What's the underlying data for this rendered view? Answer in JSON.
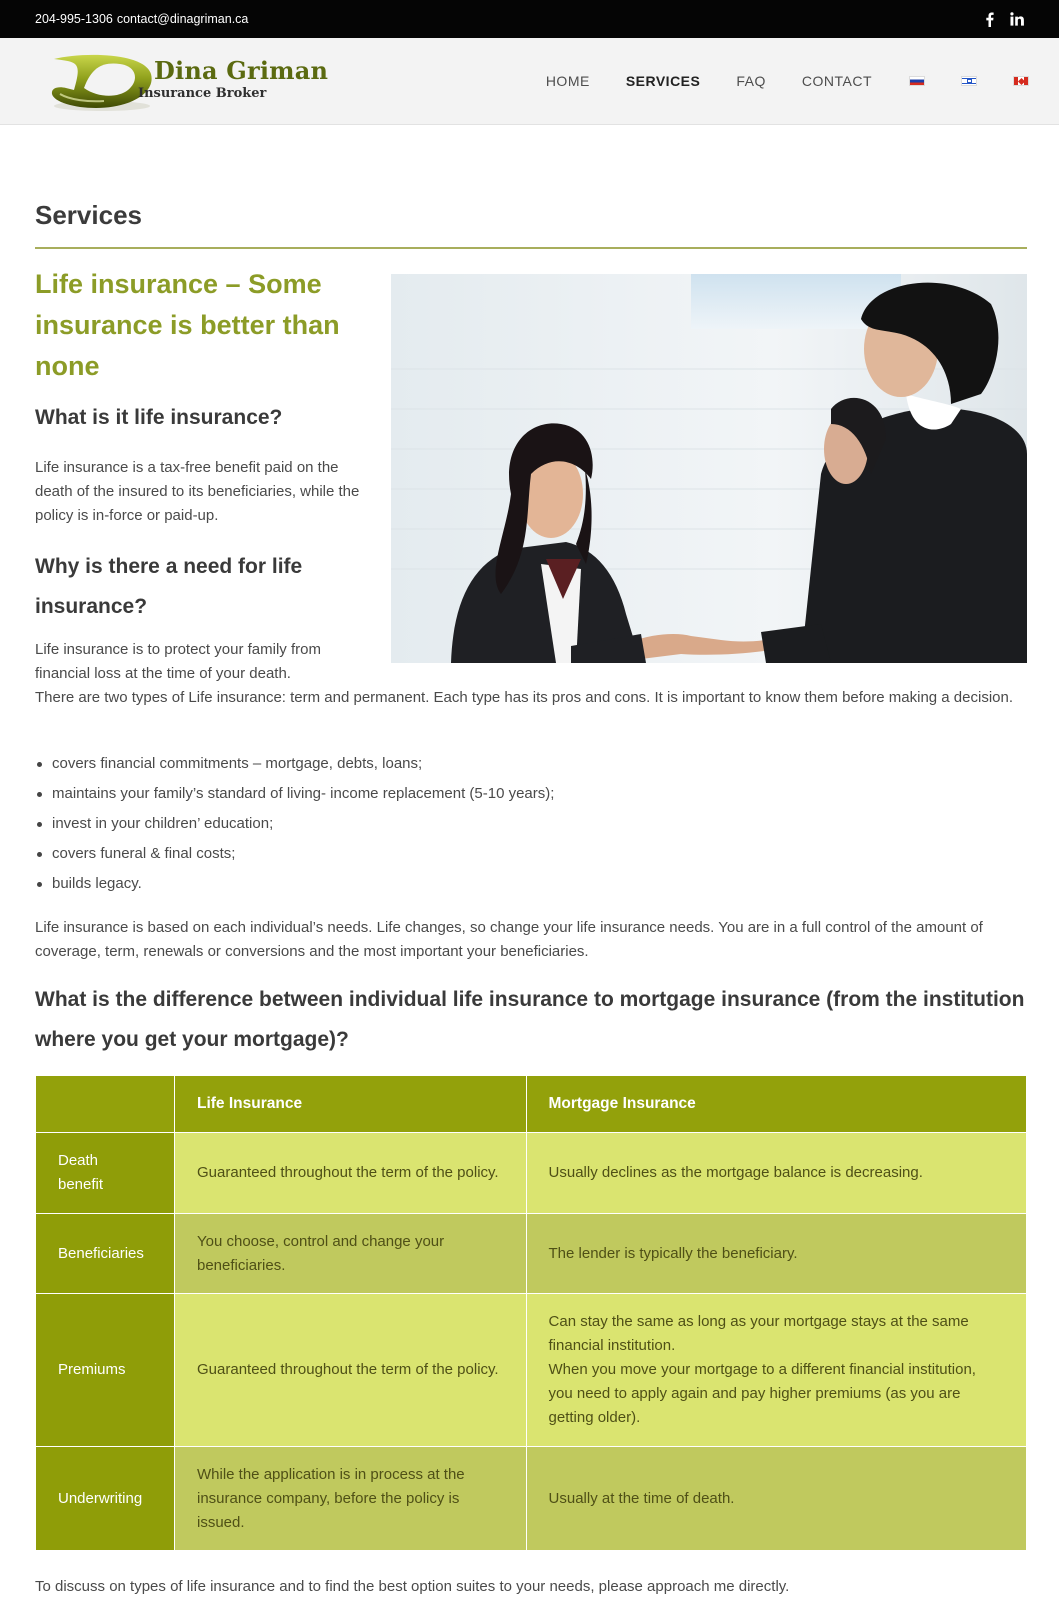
{
  "topbar": {
    "phone": "204-995-1306",
    "email": "contact@dinagriman.ca",
    "social": [
      "facebook-icon",
      "linkedin-icon"
    ]
  },
  "brand": {
    "name": "Dina Griman",
    "tagline": "Insurance Broker",
    "primary_color": "#93a10b",
    "heading_green": "#8c9c27"
  },
  "nav": {
    "items": [
      "HOME",
      "SERVICES",
      "FAQ",
      "CONTACT"
    ],
    "active": "SERVICES",
    "flags": [
      "russian-flag-icon",
      "israeli-flag-icon",
      "canadian-flag-icon"
    ]
  },
  "page": {
    "title": "Services",
    "headline": "Life insurance – Some insurance is better than none",
    "q1": "What is it life insurance?",
    "a1": "Life insurance is a tax-free benefit paid on the death of the insured to its beneficiaries, while the policy is in-force or paid-up.",
    "q2": "Why is there a need for life insurance?",
    "a2_line1": "Life insurance is to protect your family from financial loss at the time of your death.",
    "a2_line2": "There are two types of Life insurance: term and permanent. Each type has its pros and cons. It is important to know them before making a decision.",
    "bullets": [
      "covers financial commitments – mortgage, debts, loans;",
      "maintains your family’s standard of living- income replacement (5-10 years);",
      "invest in your children’ education;",
      "covers funeral & final costs;",
      "builds legacy."
    ],
    "p3": "Life insurance is based on each individual’s needs. Life changes, so change your life insurance needs. You are in a full control of the amount of coverage, term, renewals or conversions and the most important your beneficiaries.",
    "q3": "What is the difference between individual life insurance to mortgage insurance (from the institution where you get your mortgage)?",
    "closing": "To discuss on types of life insurance and to find the best option suites to your needs, please approach me directly."
  },
  "table": {
    "headers": [
      "",
      "Life Insurance",
      "Mortgage Insurance"
    ],
    "rows": [
      {
        "label": "Death benefit",
        "life": "Guaranteed throughout the term of the policy.",
        "mortgage": "Usually declines as the mortgage balance is decreasing.",
        "mortgage2": ""
      },
      {
        "label": "Beneficiaries",
        "life": "You choose, control and change your beneficiaries.",
        "mortgage": "The lender is typically the beneficiary.",
        "mortgage2": ""
      },
      {
        "label": "Premiums",
        "life": "Guaranteed throughout the term of the policy.",
        "mortgage": "Can stay the same as long as your mortgage stays at the same financial institution.",
        "mortgage2": "When you move your mortgage to a different financial institution, you need to apply again and pay higher premiums (as you are getting older)."
      },
      {
        "label": "Underwriting",
        "life": "While the application is in process at the insurance company, before the policy is issued.",
        "mortgage": "Usually at the time of death.",
        "mortgage2": ""
      }
    ]
  }
}
